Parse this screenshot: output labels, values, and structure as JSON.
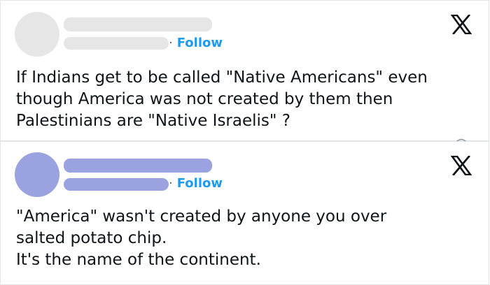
{
  "posts": [
    {
      "follow_label": "Follow",
      "separator": "·",
      "text": "If Indians get to be called \"Native Americans\" even\nthough America was not created by them then\nPalestinians are \"Native Israelis\" ?",
      "colors": {
        "avatar": "#e6e6e6",
        "placeholder_bars": "#e6e6e6"
      },
      "icons": [
        "x-logo-icon"
      ]
    },
    {
      "follow_label": "Follow",
      "separator": "·",
      "text": "\"America\" wasn't created by anyone you over\nsalted potato chip.\nIt's the name of the continent.",
      "colors": {
        "avatar": "#9aa3e0",
        "placeholder_bars": "#9aa3e0"
      },
      "icons": [
        "x-logo-icon"
      ]
    }
  ],
  "colors": {
    "follow": "#1d9bf0",
    "text": "#0f1419",
    "border": "#e3e6e8"
  }
}
